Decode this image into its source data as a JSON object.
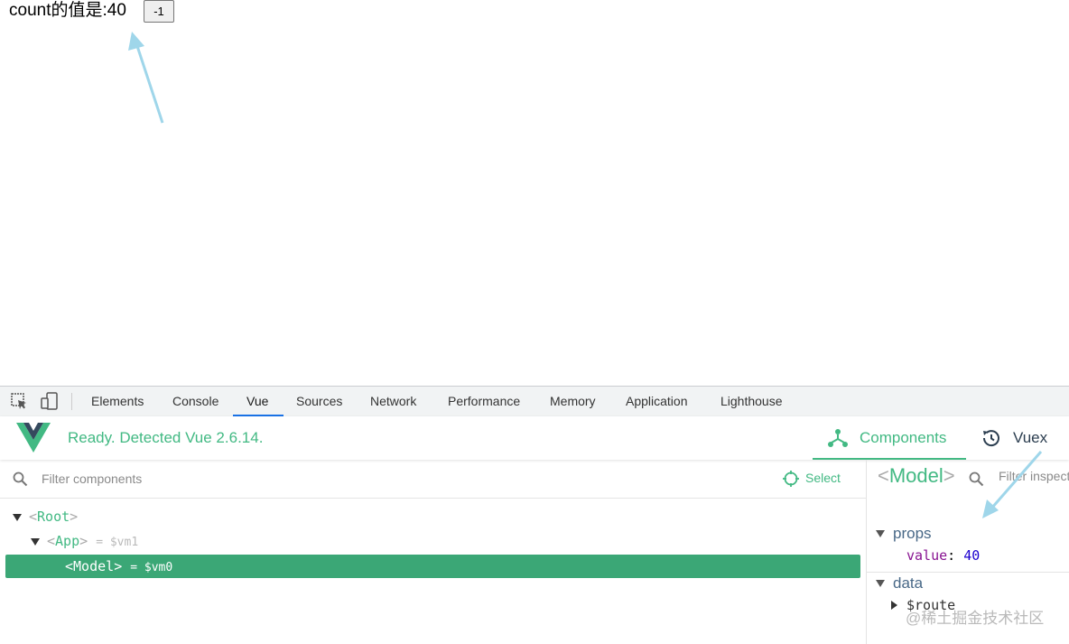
{
  "app": {
    "count_text": "count的值是:40",
    "minus_button_label": "-1"
  },
  "devtools": {
    "tabs": [
      {
        "label": "Elements"
      },
      {
        "label": "Console"
      },
      {
        "label": "Vue"
      },
      {
        "label": "Sources"
      },
      {
        "label": "Network"
      },
      {
        "label": "Performance"
      },
      {
        "label": "Memory"
      },
      {
        "label": "Application"
      },
      {
        "label": "Lighthouse"
      }
    ],
    "active_tab": "Vue"
  },
  "vue_panel": {
    "status": "Ready. Detected Vue 2.6.14.",
    "components_label": "Components",
    "vuex_label": "Vuex",
    "filter_placeholder": "Filter components",
    "select_label": "Select",
    "tree": [
      {
        "open": "<",
        "name": "Root",
        "close": ">",
        "vm": ""
      },
      {
        "open": "<",
        "name": "App",
        "close": ">",
        "vm": "= $vm1"
      },
      {
        "open": "<",
        "name": "Model",
        "close": ">",
        "vm": "= $vm0",
        "selected": true
      }
    ],
    "inspector": {
      "title_open": "<",
      "title_name": "Model",
      "title_close": ">",
      "filter_placeholder": "Filter inspected data",
      "props_label": "props",
      "prop_key": "value",
      "prop_sep": ":",
      "prop_value": "40",
      "data_label": "data",
      "data_key": "$route"
    }
  },
  "watermark": "@稀土掘金技术社区",
  "colors": {
    "vue_green": "#42b983",
    "selected_row": "#3ba776",
    "tab_underline": "#1a73e8",
    "annotation_arrow": "#9fd6ea"
  }
}
